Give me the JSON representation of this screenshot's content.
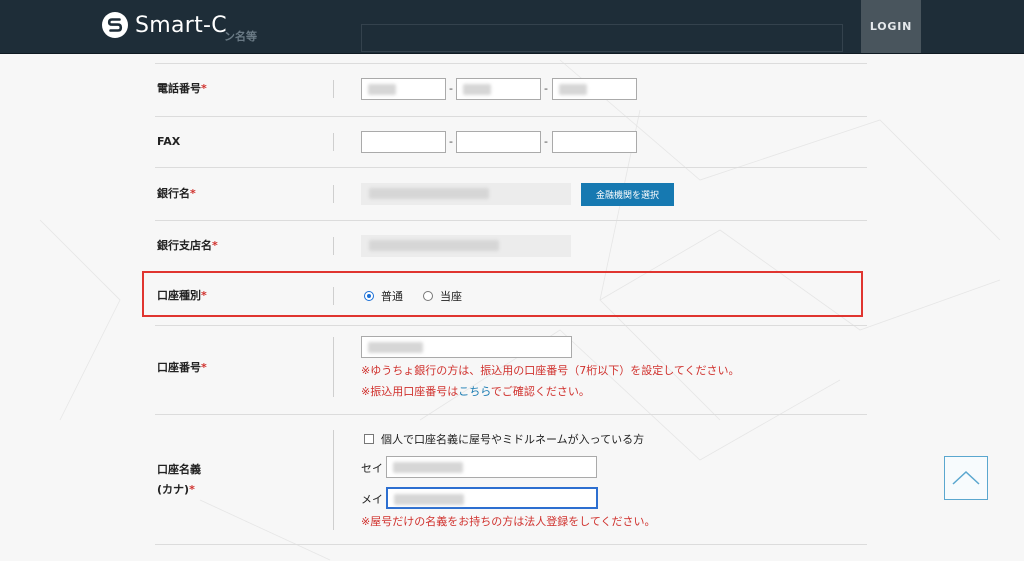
{
  "header": {
    "brand": "Smart-C",
    "ghost_label": "ン名等",
    "login": "LOGIN"
  },
  "form": {
    "phone": {
      "label": "電話番号",
      "required": "*",
      "sep1": "-",
      "sep2": "-"
    },
    "fax": {
      "label": "FAX",
      "sep1": "-",
      "sep2": "-"
    },
    "bank": {
      "label": "銀行名",
      "required": "*",
      "select_button": "金融機関を選択"
    },
    "branch": {
      "label": "銀行支店名",
      "required": "*"
    },
    "account_type": {
      "label": "口座種別",
      "required": "*",
      "options": [
        {
          "label": "普通",
          "selected": true
        },
        {
          "label": "当座",
          "selected": false
        }
      ]
    },
    "account_number": {
      "label": "口座番号",
      "required": "*",
      "note1": "※ゆうちょ銀行の方は、振込用の口座番号（7桁以下）を設定してください。",
      "note2_prefix": "※振込用口座番号は",
      "note2_link": "こちら",
      "note2_suffix": "でご確認ください。"
    },
    "account_name": {
      "label_line1": "口座名義",
      "label_line2": "(カナ)",
      "required": "*",
      "checkbox_label": "個人で口座名義に屋号やミドルネームが入っている方",
      "sei": "セイ",
      "mei": "メイ",
      "note": "※屋号だけの名義をお持ちの方は法人登録をしてください。"
    }
  },
  "colors": {
    "header_bg": "#1e2d38",
    "accent": "#1679b1",
    "required": "#d0312d",
    "highlight": "#e03530"
  }
}
